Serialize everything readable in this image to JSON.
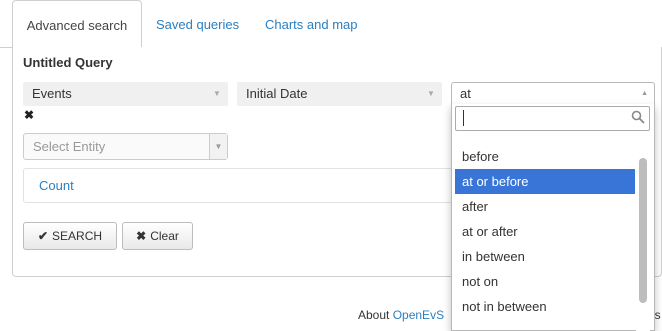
{
  "tabs": [
    {
      "label": "Advanced search"
    },
    {
      "label": "Saved queries"
    },
    {
      "label": "Charts and map"
    }
  ],
  "query": {
    "title": "Untitled Query",
    "field_select": "Events",
    "attribute_select": "Initial Date",
    "remove_icon": "✖",
    "entity_placeholder": "Select Entity",
    "count_link": "Count"
  },
  "buttons": {
    "search_icon": "✔",
    "search_label": "SEARCH",
    "clear_icon": "✖",
    "clear_label": "Clear"
  },
  "footer": {
    "about_label": "About",
    "link_text": "OpenEvS",
    "trailing_text": "ns"
  },
  "operator_dropdown": {
    "selected": "at",
    "search_value": "",
    "options": [
      "before",
      "at or before",
      "after",
      "at or after",
      "in between",
      "not on",
      "not in between"
    ],
    "highlighted_index": 1
  },
  "colors": {
    "link": "#2a7fc1",
    "highlight": "#3875d7"
  }
}
